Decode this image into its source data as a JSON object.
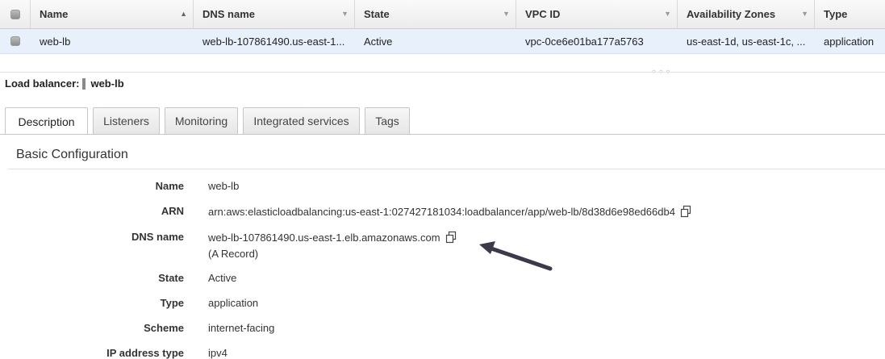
{
  "table": {
    "columns": [
      {
        "label": "Name"
      },
      {
        "label": "DNS name"
      },
      {
        "label": "State"
      },
      {
        "label": "VPC ID"
      },
      {
        "label": "Availability Zones"
      },
      {
        "label": "Type"
      }
    ],
    "rows": [
      {
        "name": "web-lb",
        "dns": "web-lb-107861490.us-east-1...",
        "state": "Active",
        "vpc": "vpc-0ce6e01ba177a5763",
        "az": "us-east-1d, us-east-1c, ...",
        "type": "application"
      }
    ]
  },
  "details": {
    "heading_label": "Load balancer:",
    "heading_name": "web-lb",
    "tabs": [
      "Description",
      "Listeners",
      "Monitoring",
      "Integrated services",
      "Tags"
    ],
    "active_tab": "Description",
    "section_title": "Basic Configuration",
    "fields": {
      "name": {
        "label": "Name",
        "value": "web-lb"
      },
      "arn": {
        "label": "ARN",
        "value": "arn:aws:elasticloadbalancing:us-east-1:027427181034:loadbalancer/app/web-lb/8d38d6e98ed66db4"
      },
      "dns": {
        "label": "DNS name",
        "value": "web-lb-107861490.us-east-1.elb.amazonaws.com",
        "note": "(A Record)"
      },
      "state": {
        "label": "State",
        "value": "Active"
      },
      "type": {
        "label": "Type",
        "value": "application"
      },
      "scheme": {
        "label": "Scheme",
        "value": "internet-facing"
      },
      "ip_type": {
        "label": "IP address type",
        "value": "ipv4"
      }
    }
  },
  "icons": {
    "copy": "copy-icon",
    "sort": "sort-ascending-icon",
    "filter": "chevron-down-icon"
  },
  "colors": {
    "selected_row": "#e8f1fb",
    "header_bg": "#ececec",
    "arrow": "#3a3a4a"
  }
}
